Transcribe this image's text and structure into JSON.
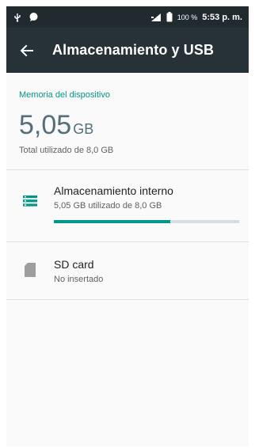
{
  "status_bar": {
    "battery_percent": "100 %",
    "time": "5:53 p. m."
  },
  "app_bar": {
    "title": "Almacenamiento y USB"
  },
  "section": {
    "header": "Memoria del dispositivo"
  },
  "summary": {
    "used_value": "5,05",
    "used_unit": "GB",
    "subtitle": "Total utilizado de 8,0 GB"
  },
  "storage_items": [
    {
      "title": "Almacenamiento interno",
      "subtitle": "5,05 GB utilizado de 8,0 GB",
      "usage_fraction": 0.63,
      "icon": "storage-icon"
    },
    {
      "title": "SD card",
      "subtitle": "No insertado",
      "icon": "sd-card-icon"
    }
  ],
  "colors": {
    "status_bar": "#212a2f",
    "app_bar": "#263238",
    "accent": "#009688"
  }
}
